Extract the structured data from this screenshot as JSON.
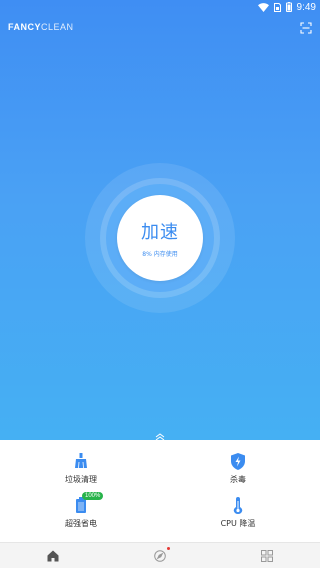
{
  "status_bar": {
    "time": "9:49",
    "icons": [
      "wifi-icon",
      "sim-card-icon",
      "battery-icon"
    ]
  },
  "app": {
    "brand_bold": "FANCY",
    "brand_light": "CLEAN",
    "scan_icon": "scan-icon"
  },
  "boost": {
    "title": "加速",
    "subtitle": "8% 内存使用"
  },
  "features": [
    {
      "label": "垃圾清理",
      "icon": "broom-icon"
    },
    {
      "label": "杀毒",
      "icon": "shield-bolt-icon"
    },
    {
      "label": "超强省电",
      "icon": "battery-icon",
      "badge": "100%"
    },
    {
      "label": "CPU 降温",
      "icon": "thermometer-icon"
    }
  ],
  "bottom_nav": {
    "items": [
      "home-icon",
      "compass-icon",
      "grid-icon"
    ]
  },
  "colors": {
    "primary": "#3b8cf0",
    "badge": "#27b34a"
  }
}
